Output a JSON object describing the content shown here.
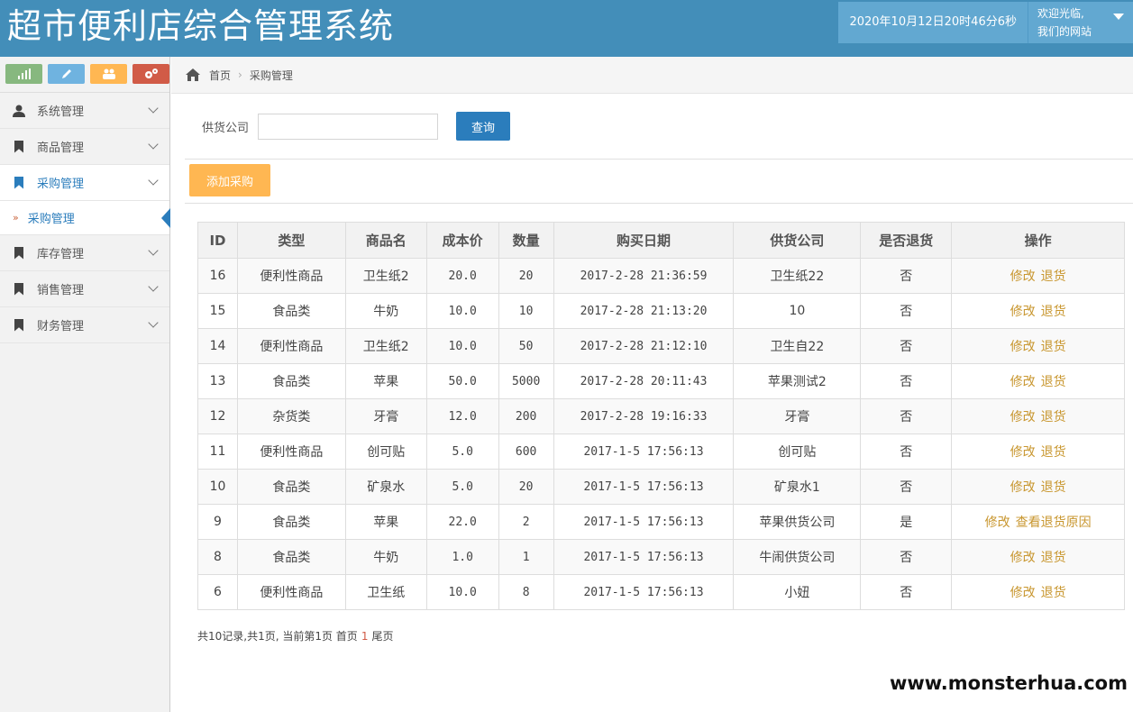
{
  "header": {
    "title": "超市便利店综合管理系统",
    "datetime": "2020年10月12日20时46分6秒",
    "welcome_line1": "欢迎光临,",
    "welcome_line2": "我们的网站"
  },
  "sidebar": {
    "shortcuts": [
      {
        "icon": "signal-icon",
        "color": "#87b87f"
      },
      {
        "icon": "pencil-icon",
        "color": "#6fb3e0"
      },
      {
        "icon": "users-icon",
        "color": "#ffb752"
      },
      {
        "icon": "cogs-icon",
        "color": "#d15b47"
      }
    ],
    "items": [
      {
        "label": "系统管理",
        "icon": "user-icon"
      },
      {
        "label": "商品管理",
        "icon": "bookmark-icon"
      },
      {
        "label": "采购管理",
        "icon": "bookmark-icon",
        "active": true
      },
      {
        "label": "库存管理",
        "icon": "bookmark-icon"
      },
      {
        "label": "销售管理",
        "icon": "bookmark-icon"
      },
      {
        "label": "财务管理",
        "icon": "bookmark-icon"
      }
    ],
    "submenu_label": "采购管理"
  },
  "breadcrumb": {
    "home": "首页",
    "current": "采购管理"
  },
  "search": {
    "label": "供货公司",
    "value": "",
    "button": "查询"
  },
  "toolbar": {
    "add_label": "添加采购"
  },
  "table": {
    "headers": [
      "ID",
      "类型",
      "商品名",
      "成本价",
      "数量",
      "购买日期",
      "供货公司",
      "是否退货",
      "操作"
    ],
    "rows": [
      {
        "id": "16",
        "type": "便利性商品",
        "name": "卫生纸2",
        "cost": "20.0",
        "qty": "20",
        "date": "2017-2-28 21:36:59",
        "supplier": "卫生纸22",
        "returned": "否",
        "ops": [
          "修改",
          "退货"
        ]
      },
      {
        "id": "15",
        "type": "食品类",
        "name": "牛奶",
        "cost": "10.0",
        "qty": "10",
        "date": "2017-2-28 21:13:20",
        "supplier": "10",
        "returned": "否",
        "ops": [
          "修改",
          "退货"
        ]
      },
      {
        "id": "14",
        "type": "便利性商品",
        "name": "卫生纸2",
        "cost": "10.0",
        "qty": "50",
        "date": "2017-2-28 21:12:10",
        "supplier": "卫生自22",
        "returned": "否",
        "ops": [
          "修改",
          "退货"
        ]
      },
      {
        "id": "13",
        "type": "食品类",
        "name": "苹果",
        "cost": "50.0",
        "qty": "5000",
        "date": "2017-2-28 20:11:43",
        "supplier": "苹果测试2",
        "returned": "否",
        "ops": [
          "修改",
          "退货"
        ]
      },
      {
        "id": "12",
        "type": "杂货类",
        "name": "牙膏",
        "cost": "12.0",
        "qty": "200",
        "date": "2017-2-28 19:16:33",
        "supplier": "牙膏",
        "returned": "否",
        "ops": [
          "修改",
          "退货"
        ]
      },
      {
        "id": "11",
        "type": "便利性商品",
        "name": "创可贴",
        "cost": "5.0",
        "qty": "600",
        "date": "2017-1-5 17:56:13",
        "supplier": "创可贴",
        "returned": "否",
        "ops": [
          "修改",
          "退货"
        ]
      },
      {
        "id": "10",
        "type": "食品类",
        "name": "矿泉水",
        "cost": "5.0",
        "qty": "20",
        "date": "2017-1-5 17:56:13",
        "supplier": "矿泉水1",
        "returned": "否",
        "ops": [
          "修改",
          "退货"
        ]
      },
      {
        "id": "9",
        "type": "食品类",
        "name": "苹果",
        "cost": "22.0",
        "qty": "2",
        "date": "2017-1-5 17:56:13",
        "supplier": "苹果供货公司",
        "returned": "是",
        "ops": [
          "修改",
          "查看退货原因"
        ]
      },
      {
        "id": "8",
        "type": "食品类",
        "name": "牛奶",
        "cost": "1.0",
        "qty": "1",
        "date": "2017-1-5 17:56:13",
        "supplier": "牛闹供货公司",
        "returned": "否",
        "ops": [
          "修改",
          "退货"
        ]
      },
      {
        "id": "6",
        "type": "便利性商品",
        "name": "卫生纸",
        "cost": "10.0",
        "qty": "8",
        "date": "2017-1-5 17:56:13",
        "supplier": "小妞",
        "returned": "否",
        "ops": [
          "修改",
          "退货"
        ]
      }
    ]
  },
  "pager": {
    "summary": "共10记录,共1页, 当前第1页 首页",
    "current": "1",
    "last": "尾页"
  },
  "watermark": "www.monsterhua.com"
}
